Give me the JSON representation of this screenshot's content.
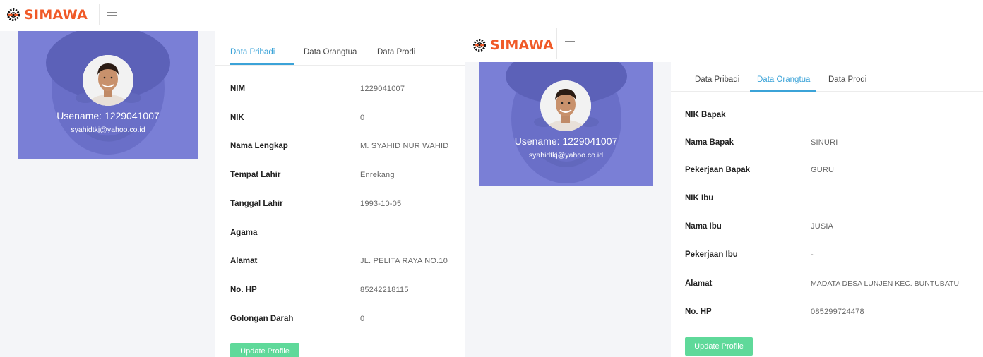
{
  "brand": {
    "name": "SIMAWA",
    "color": "#f05a28"
  },
  "colors": {
    "card_bg": "#7a7fd6",
    "tab_active": "#3ba3d8",
    "button_bg": "#5fd99a"
  },
  "icons": {
    "logo": "simawa-logo-icon",
    "menu": "hamburger-menu-icon"
  },
  "profile": {
    "username_label": "Usename: 1229041007",
    "email": "syahidtkj@yahoo.co.id"
  },
  "left": {
    "tabs": [
      "Data Pribadi",
      "Data Orangtua",
      "Data Prodi"
    ],
    "active_tab": "Data Pribadi",
    "rows": [
      {
        "label": "NIM",
        "value": "1229041007"
      },
      {
        "label": "NIK",
        "value": "0"
      },
      {
        "label": "Nama Lengkap",
        "value": "M. SYAHID NUR WAHID"
      },
      {
        "label": "Tempat Lahir",
        "value": "Enrekang"
      },
      {
        "label": "Tanggal Lahir",
        "value": "1993-10-05"
      },
      {
        "label": "Agama",
        "value": ""
      },
      {
        "label": "Alamat",
        "value": "JL. PELITA RAYA NO.10"
      },
      {
        "label": "No. HP",
        "value": "85242218115"
      },
      {
        "label": "Golongan Darah",
        "value": "0"
      }
    ],
    "update_button": "Update Profile"
  },
  "right": {
    "tabs": [
      "Data Pribadi",
      "Data Orangtua",
      "Data Prodi"
    ],
    "active_tab": "Data Orangtua",
    "rows": [
      {
        "label": "NIK Bapak",
        "value": ""
      },
      {
        "label": "Nama Bapak",
        "value": "SINURI"
      },
      {
        "label": "Pekerjaan Bapak",
        "value": "GURU"
      },
      {
        "label": "NIK Ibu",
        "value": ""
      },
      {
        "label": "Nama Ibu",
        "value": "JUSIA"
      },
      {
        "label": "Pekerjaan Ibu",
        "value": "-"
      },
      {
        "label": "Alamat",
        "value": "MADATA DESA LUNJEN KEC. BUNTUBATU"
      },
      {
        "label": "No. HP",
        "value": "085299724478"
      }
    ],
    "update_button": "Update Profile"
  }
}
